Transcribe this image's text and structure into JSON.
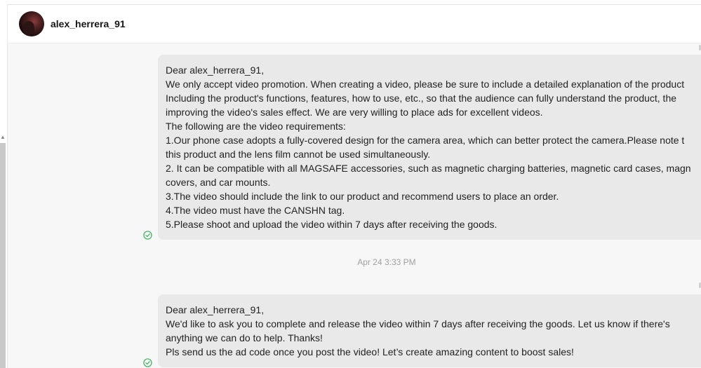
{
  "conversation": {
    "username": "alex_herrera_91"
  },
  "messages": [
    {
      "lines": [
        "Dear alex_herrera_91,",
        "We only accept video promotion. When creating a video, please be sure to include a detailed explanation of the product",
        "Including the product's functions, features, how to use, etc., so that the audience can fully understand the product, the",
        "improving the video's sales effect. We are very willing to place ads for excellent videos.",
        "The following are the video requirements:",
        "1.Our phone case adopts a fully-covered design for the camera area, which can better protect the camera.Please note t",
        "this product and the lens film cannot be used simultaneously.",
        "2. It can be compatible with all MAGSAFE accessories, such as magnetic charging batteries, magnetic card cases, magn",
        "covers, and car mounts.",
        "3.The video should include the link to our product and recommend users to place an order.",
        "4.The video must have the CANSHN tag.",
        "5.Please shoot and upload the video within 7 days after receiving the goods."
      ],
      "status_icon": "check-circle-icon"
    },
    {
      "lines": [
        "Dear alex_herrera_91,",
        "We'd like to ask you to complete and release the video within 7 days after receiving the goods. Let us know if there's",
        "anything we can do to help. Thanks!",
        "Pls send us the ad code once you post the video! Let’s create amazing content to boost sales!"
      ],
      "status_icon": "check-circle-icon"
    }
  ],
  "timestamp": "Apr 24 3:33 PM",
  "colors": {
    "bubble": "#e9e9e9",
    "chat_background": "#f7f7f7",
    "read_check": "#3cb35a",
    "timestamp": "#a0a0a0"
  }
}
